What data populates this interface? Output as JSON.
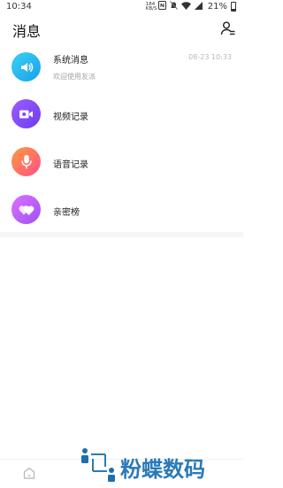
{
  "status_bar": {
    "time": "10:34",
    "net_speed": "184\nKB/S",
    "battery": "21%"
  },
  "header": {
    "title": "消息",
    "contacts_icon": "contacts-icon"
  },
  "messages": [
    {
      "title": "系统消息",
      "subtitle": "欢迎使用友派",
      "time": "08-23 10:33",
      "icon": "speaker-icon",
      "gradient": [
        "#3ad2f0",
        "#1a9ff0"
      ]
    },
    {
      "title": "视频记录",
      "icon": "video-camera-icon",
      "gradient": [
        "#a05bff",
        "#6a3df0"
      ]
    },
    {
      "title": "语音记录",
      "icon": "microphone-icon",
      "gradient": [
        "#ff9a3c",
        "#ff4f8a"
      ]
    },
    {
      "title": "亲密榜",
      "icon": "heart-icon",
      "gradient": [
        "#e070ff",
        "#9a52f2"
      ]
    }
  ],
  "tabbar": {
    "home_icon": "home-icon"
  },
  "watermark": {
    "text": "粉蝶数码"
  }
}
